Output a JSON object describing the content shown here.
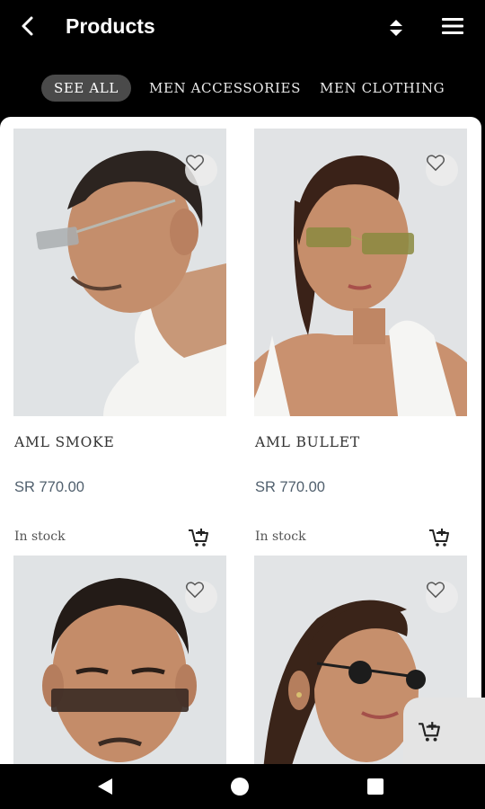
{
  "header": {
    "title": "Products",
    "back_icon": "back-arrow-icon",
    "sort_icon": "sort-icon",
    "menu_icon": "hamburger-menu-icon"
  },
  "tabs": [
    {
      "label": "SEE ALL",
      "active": true
    },
    {
      "label": "MEN ACCESSORIES",
      "active": false
    },
    {
      "label": "MEN CLOTHING",
      "active": false
    }
  ],
  "products": [
    {
      "name": "AML SMOKE",
      "price": "SR 770.00",
      "stock": "In stock"
    },
    {
      "name": "AML BULLET",
      "price": "SR 770.00",
      "stock": "In stock"
    },
    {
      "name": "",
      "price": "",
      "stock": ""
    },
    {
      "name": "",
      "price": "",
      "stock": ""
    }
  ],
  "colors": {
    "background": "#000000",
    "accent_tab": "#4a4a4a",
    "price": "#51606e",
    "photo_bg": "#dfe2e4"
  }
}
